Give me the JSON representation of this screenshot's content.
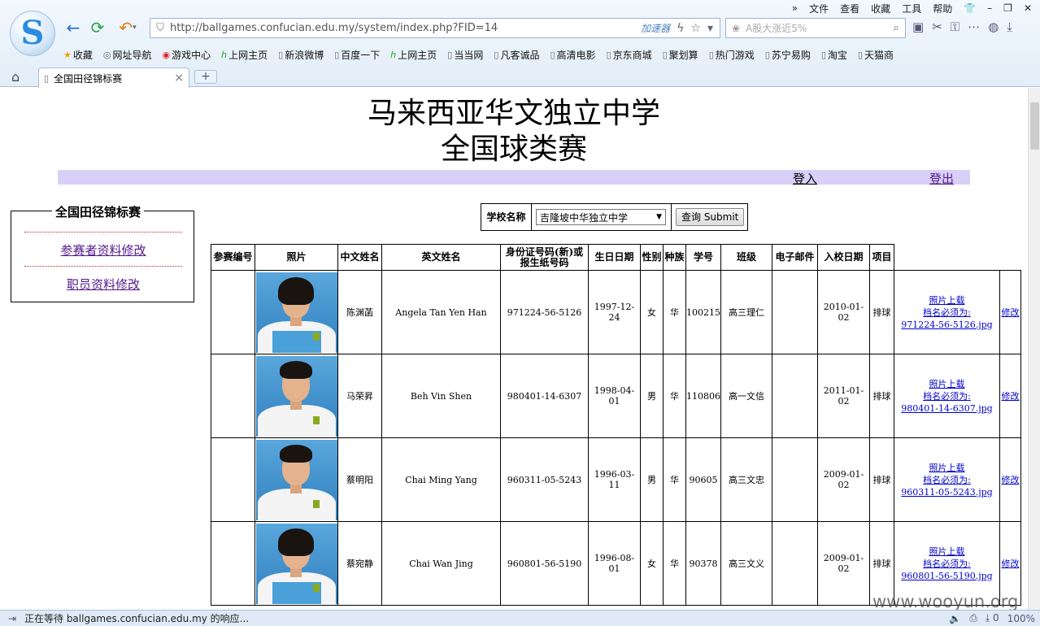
{
  "menubar": [
    "»",
    "文件",
    "查看",
    "收藏",
    "工具",
    "帮助",
    "👕",
    "–",
    "❐",
    "✕"
  ],
  "url": "http://ballgames.confucian.edu.my/system/index.php?FID=14",
  "url_accel": "加速器",
  "search_placeholder": "A股大涨近5%",
  "bookmarks": [
    "收藏",
    "网址导航",
    "游戏中心",
    "上网主页",
    "新浪微博",
    "百度一下",
    "上网主页",
    "当当网",
    "凡客诚品",
    "高清电影",
    "京东商城",
    "聚划算",
    "热门游戏",
    "苏宁易购",
    "淘宝",
    "天猫商"
  ],
  "tab_title": "全国田径锦标赛",
  "page": {
    "title1": "马来西亚华文独立中学",
    "title2": "全国球类赛",
    "login": "登入",
    "logout": "登出",
    "side_title": "全国田径锦标赛",
    "side_link1": "参赛者资料修改",
    "side_link2": "职员资料修改",
    "school_label": "学校名称",
    "school_value": "吉隆坡中华独立中学",
    "submit": "查询 Submit"
  },
  "table": {
    "headers": [
      "参赛编号",
      "照片",
      "中文姓名",
      "英文姓名",
      "身份证号码(新)或报生纸号码",
      "生日日期",
      "性别",
      "种族",
      "学号",
      "班级",
      "电子邮件",
      "入校日期",
      "项目"
    ],
    "upload_label": "照片上载",
    "filename_label": "档名必须为:",
    "edit_label": "修改",
    "rows": [
      {
        "cn": "陈渊菡",
        "en": "Angela Tan Yen Han",
        "ic": "971224-56-5126",
        "dob": "1997-12-24",
        "sex": "女",
        "race": "华",
        "sid": "100215",
        "cls": "高三理仁",
        "email": "",
        "join": "2010-01-02",
        "event": "排球",
        "file": "971224-56-5126.jpg"
      },
      {
        "cn": "马荣昇",
        "en": "Beh Vin Shen",
        "ic": "980401-14-6307",
        "dob": "1998-04-01",
        "sex": "男",
        "race": "华",
        "sid": "110806",
        "cls": "高一文信",
        "email": "",
        "join": "2011-01-02",
        "event": "排球",
        "file": "980401-14-6307.jpg"
      },
      {
        "cn": "蔡明阳",
        "en": "Chai Ming Yang",
        "ic": "960311-05-5243",
        "dob": "1996-03-11",
        "sex": "男",
        "race": "华",
        "sid": "90605",
        "cls": "高三文忠",
        "email": "",
        "join": "2009-01-02",
        "event": "排球",
        "file": "960311-05-5243.jpg"
      },
      {
        "cn": "蔡宛静",
        "en": "Chai Wan Jing",
        "ic": "960801-56-5190",
        "dob": "1996-08-01",
        "sex": "女",
        "race": "华",
        "sid": "90378",
        "cls": "高三文义",
        "email": "",
        "join": "2009-01-02",
        "event": "排球",
        "file": "960801-56-5190.jpg"
      }
    ]
  },
  "watermark": "www.wooyun.org",
  "status_text": "正在等待 ballgames.confucian.edu.my 的响应...",
  "zoom": "100%"
}
